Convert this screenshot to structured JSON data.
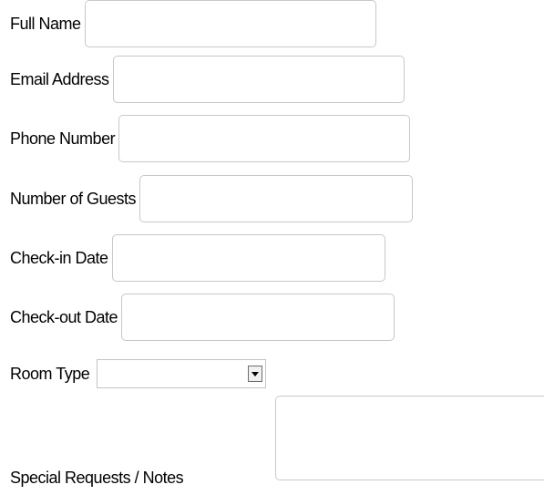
{
  "form": {
    "fields": [
      {
        "label": "Full Name",
        "value": "",
        "placeholder": ""
      },
      {
        "label": "Email Address",
        "value": "",
        "placeholder": ""
      },
      {
        "label": "Phone Number",
        "value": "",
        "placeholder": ""
      },
      {
        "label": "Number of Guests",
        "value": "",
        "placeholder": ""
      },
      {
        "label": "Check-in Date",
        "value": "",
        "placeholder": ""
      },
      {
        "label": "Check-out Date",
        "value": "",
        "placeholder": ""
      }
    ],
    "room_type": {
      "label": "Room Type",
      "selected": "",
      "icon": "chevron-down-icon"
    },
    "notes": {
      "label": "Special Requests / Notes",
      "value": "",
      "placeholder": ""
    }
  },
  "colors": {
    "border": "#c8c8c8",
    "text": "#000000",
    "background": "#ffffff"
  }
}
